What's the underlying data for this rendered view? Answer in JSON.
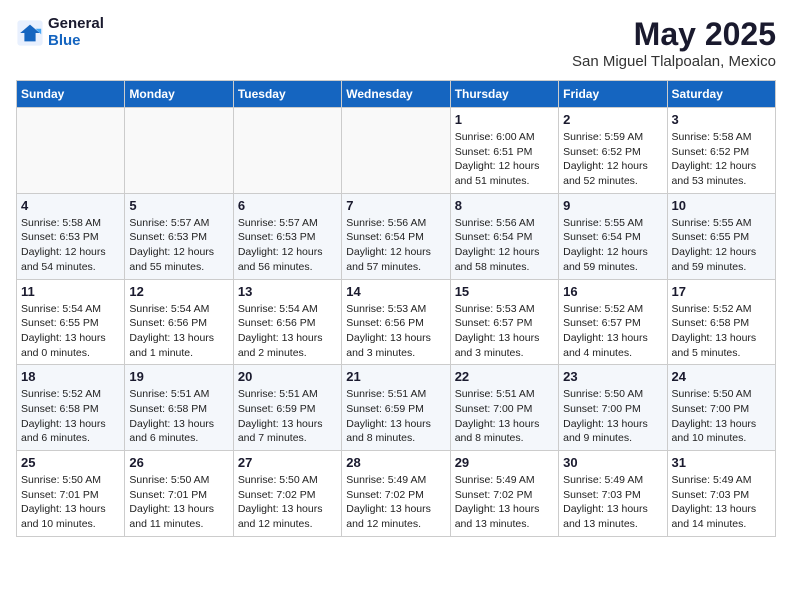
{
  "logo": {
    "general": "General",
    "blue": "Blue"
  },
  "title": "May 2025",
  "location": "San Miguel Tlalpoalan, Mexico",
  "days_header": [
    "Sunday",
    "Monday",
    "Tuesday",
    "Wednesday",
    "Thursday",
    "Friday",
    "Saturday"
  ],
  "weeks": [
    [
      {
        "day": "",
        "info": ""
      },
      {
        "day": "",
        "info": ""
      },
      {
        "day": "",
        "info": ""
      },
      {
        "day": "",
        "info": ""
      },
      {
        "day": "1",
        "info": "Sunrise: 6:00 AM\nSunset: 6:51 PM\nDaylight: 12 hours\nand 51 minutes."
      },
      {
        "day": "2",
        "info": "Sunrise: 5:59 AM\nSunset: 6:52 PM\nDaylight: 12 hours\nand 52 minutes."
      },
      {
        "day": "3",
        "info": "Sunrise: 5:58 AM\nSunset: 6:52 PM\nDaylight: 12 hours\nand 53 minutes."
      }
    ],
    [
      {
        "day": "4",
        "info": "Sunrise: 5:58 AM\nSunset: 6:53 PM\nDaylight: 12 hours\nand 54 minutes."
      },
      {
        "day": "5",
        "info": "Sunrise: 5:57 AM\nSunset: 6:53 PM\nDaylight: 12 hours\nand 55 minutes."
      },
      {
        "day": "6",
        "info": "Sunrise: 5:57 AM\nSunset: 6:53 PM\nDaylight: 12 hours\nand 56 minutes."
      },
      {
        "day": "7",
        "info": "Sunrise: 5:56 AM\nSunset: 6:54 PM\nDaylight: 12 hours\nand 57 minutes."
      },
      {
        "day": "8",
        "info": "Sunrise: 5:56 AM\nSunset: 6:54 PM\nDaylight: 12 hours\nand 58 minutes."
      },
      {
        "day": "9",
        "info": "Sunrise: 5:55 AM\nSunset: 6:54 PM\nDaylight: 12 hours\nand 59 minutes."
      },
      {
        "day": "10",
        "info": "Sunrise: 5:55 AM\nSunset: 6:55 PM\nDaylight: 12 hours\nand 59 minutes."
      }
    ],
    [
      {
        "day": "11",
        "info": "Sunrise: 5:54 AM\nSunset: 6:55 PM\nDaylight: 13 hours\nand 0 minutes."
      },
      {
        "day": "12",
        "info": "Sunrise: 5:54 AM\nSunset: 6:56 PM\nDaylight: 13 hours\nand 1 minute."
      },
      {
        "day": "13",
        "info": "Sunrise: 5:54 AM\nSunset: 6:56 PM\nDaylight: 13 hours\nand 2 minutes."
      },
      {
        "day": "14",
        "info": "Sunrise: 5:53 AM\nSunset: 6:56 PM\nDaylight: 13 hours\nand 3 minutes."
      },
      {
        "day": "15",
        "info": "Sunrise: 5:53 AM\nSunset: 6:57 PM\nDaylight: 13 hours\nand 3 minutes."
      },
      {
        "day": "16",
        "info": "Sunrise: 5:52 AM\nSunset: 6:57 PM\nDaylight: 13 hours\nand 4 minutes."
      },
      {
        "day": "17",
        "info": "Sunrise: 5:52 AM\nSunset: 6:58 PM\nDaylight: 13 hours\nand 5 minutes."
      }
    ],
    [
      {
        "day": "18",
        "info": "Sunrise: 5:52 AM\nSunset: 6:58 PM\nDaylight: 13 hours\nand 6 minutes."
      },
      {
        "day": "19",
        "info": "Sunrise: 5:51 AM\nSunset: 6:58 PM\nDaylight: 13 hours\nand 6 minutes."
      },
      {
        "day": "20",
        "info": "Sunrise: 5:51 AM\nSunset: 6:59 PM\nDaylight: 13 hours\nand 7 minutes."
      },
      {
        "day": "21",
        "info": "Sunrise: 5:51 AM\nSunset: 6:59 PM\nDaylight: 13 hours\nand 8 minutes."
      },
      {
        "day": "22",
        "info": "Sunrise: 5:51 AM\nSunset: 7:00 PM\nDaylight: 13 hours\nand 8 minutes."
      },
      {
        "day": "23",
        "info": "Sunrise: 5:50 AM\nSunset: 7:00 PM\nDaylight: 13 hours\nand 9 minutes."
      },
      {
        "day": "24",
        "info": "Sunrise: 5:50 AM\nSunset: 7:00 PM\nDaylight: 13 hours\nand 10 minutes."
      }
    ],
    [
      {
        "day": "25",
        "info": "Sunrise: 5:50 AM\nSunset: 7:01 PM\nDaylight: 13 hours\nand 10 minutes."
      },
      {
        "day": "26",
        "info": "Sunrise: 5:50 AM\nSunset: 7:01 PM\nDaylight: 13 hours\nand 11 minutes."
      },
      {
        "day": "27",
        "info": "Sunrise: 5:50 AM\nSunset: 7:02 PM\nDaylight: 13 hours\nand 12 minutes."
      },
      {
        "day": "28",
        "info": "Sunrise: 5:49 AM\nSunset: 7:02 PM\nDaylight: 13 hours\nand 12 minutes."
      },
      {
        "day": "29",
        "info": "Sunrise: 5:49 AM\nSunset: 7:02 PM\nDaylight: 13 hours\nand 13 minutes."
      },
      {
        "day": "30",
        "info": "Sunrise: 5:49 AM\nSunset: 7:03 PM\nDaylight: 13 hours\nand 13 minutes."
      },
      {
        "day": "31",
        "info": "Sunrise: 5:49 AM\nSunset: 7:03 PM\nDaylight: 13 hours\nand 14 minutes."
      }
    ]
  ]
}
